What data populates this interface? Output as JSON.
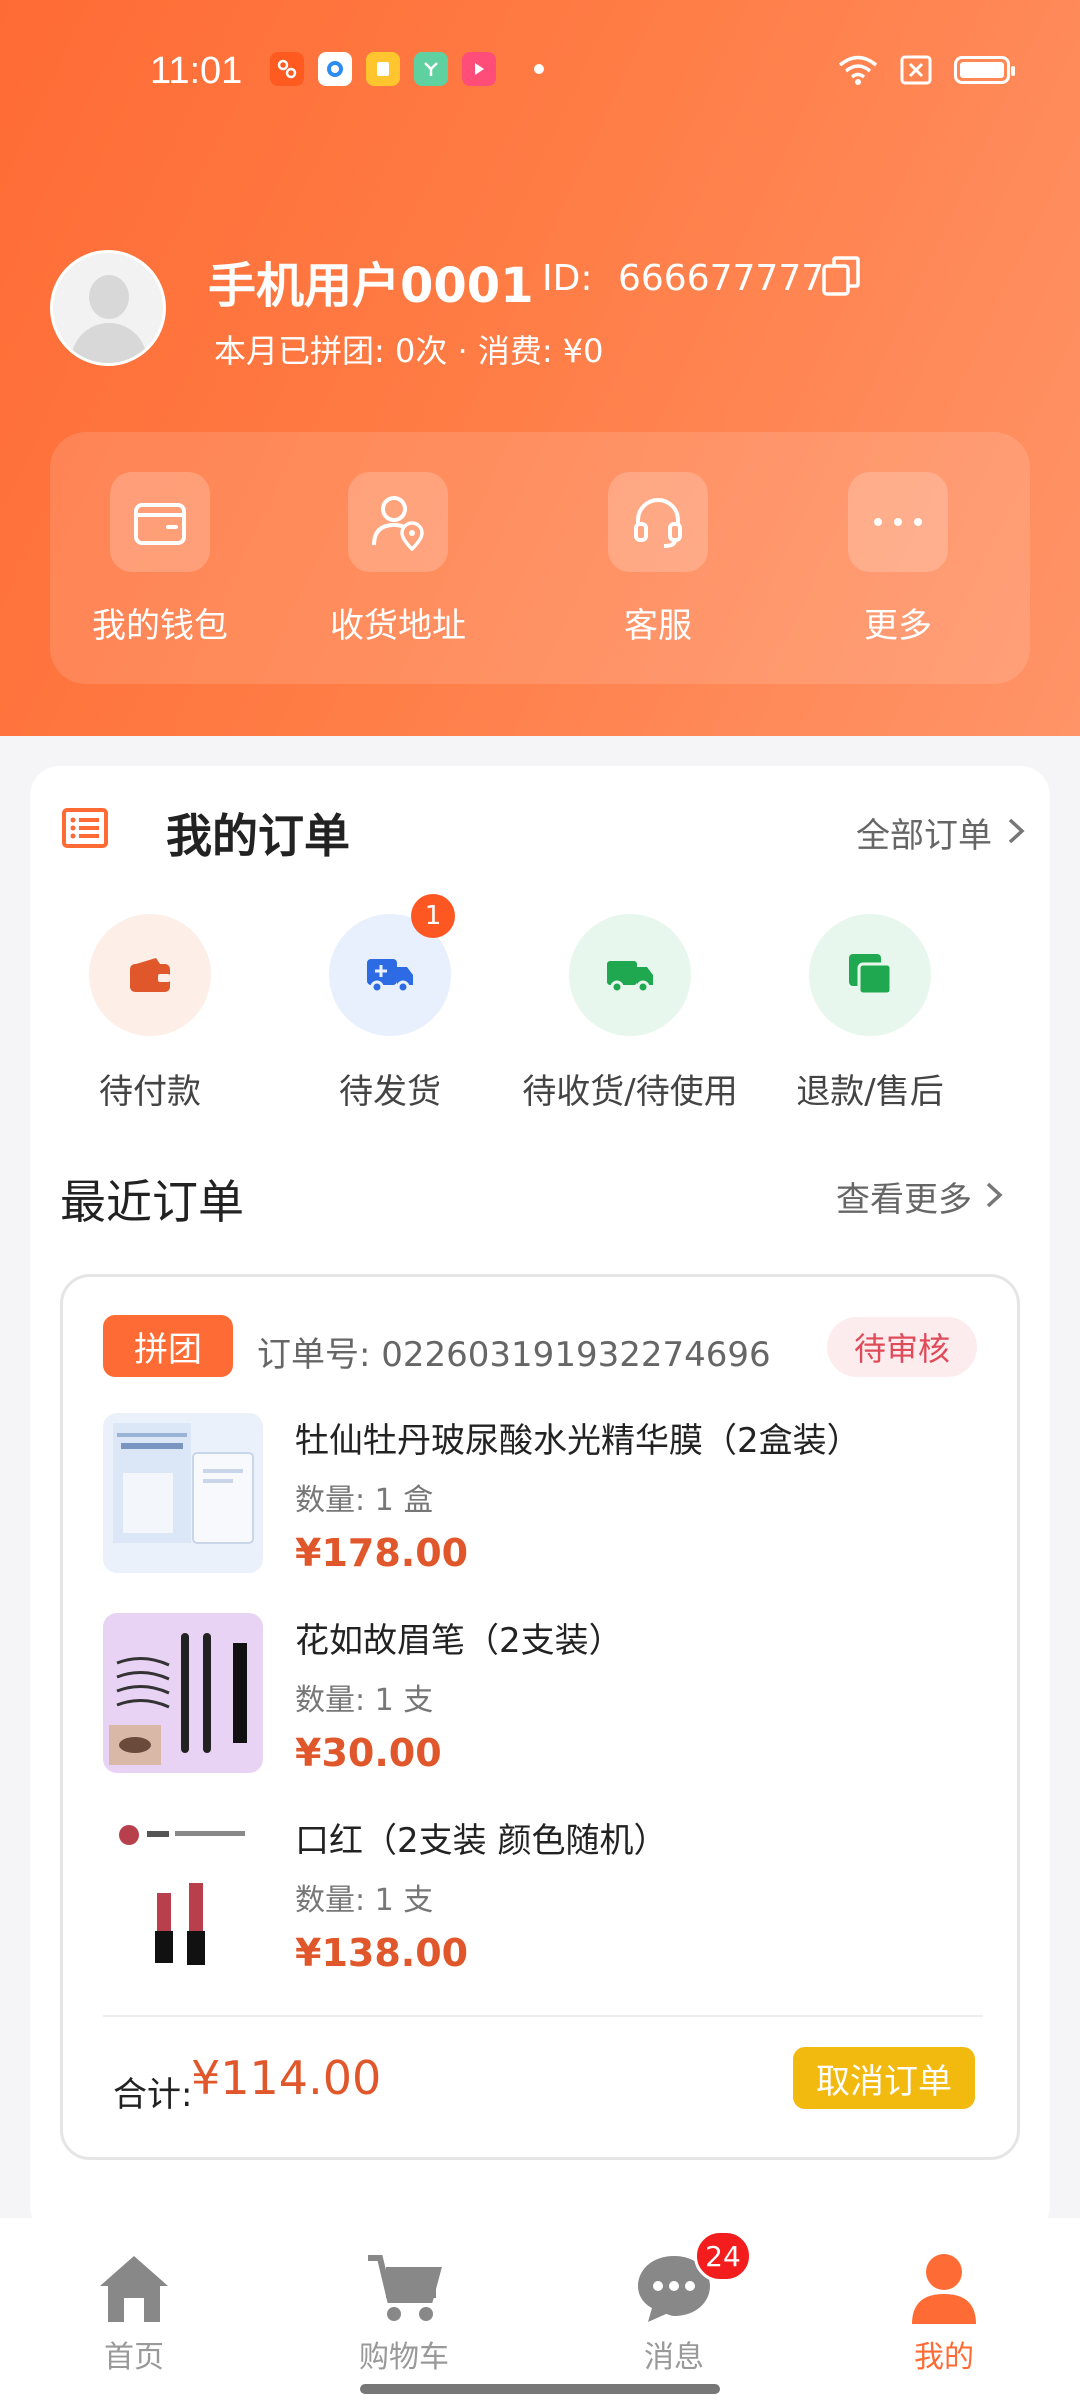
{
  "status_bar": {
    "time": "11:01"
  },
  "profile": {
    "username": "手机用户0001",
    "id_label": "ID:",
    "id_value": "666677777",
    "stats": "本月已拼团: 0次 · 消费: ¥0"
  },
  "quick_actions": [
    {
      "label": "我的钱包",
      "icon": "wallet-icon"
    },
    {
      "label": "收货地址",
      "icon": "location-user-icon"
    },
    {
      "label": "客服",
      "icon": "headset-icon"
    },
    {
      "label": "更多",
      "icon": "more-icon"
    }
  ],
  "orders": {
    "title": "我的订单",
    "all_orders": "全部订单",
    "statuses": [
      {
        "label": "待付款",
        "icon": "wallet-icon",
        "color": "#e0572b",
        "bg": "#fdeee8",
        "badge": ""
      },
      {
        "label": "待发货",
        "icon": "truck-icon",
        "color": "#2d6be4",
        "bg": "#e8f0fd",
        "badge": "1"
      },
      {
        "label": "待收货/待使用",
        "icon": "delivery-truck-icon",
        "color": "#1fa84f",
        "bg": "#e8f7ed",
        "badge": ""
      },
      {
        "label": "退款/售后",
        "icon": "refund-icon",
        "color": "#1fa84f",
        "bg": "#e8f7ed",
        "badge": ""
      }
    ]
  },
  "recent": {
    "title": "最近订单",
    "view_more": "查看更多",
    "order": {
      "tag": "拼团",
      "order_no": "订单号: 022603191932274696",
      "status": "待审核",
      "products": [
        {
          "name": "牡仙牡丹玻尿酸水光精华膜（2盒装）",
          "qty": "数量: 1 盒",
          "price": "¥178.00"
        },
        {
          "name": "花如故眉笔（2支装）",
          "qty": "数量: 1 支",
          "price": "¥30.00"
        },
        {
          "name": "口红（2支装 颜色随机）",
          "qty": "数量: 1 支",
          "price": "¥138.00"
        }
      ],
      "total_label": "合计:",
      "total_value": "¥114.00",
      "cancel": "取消订单"
    }
  },
  "bottom_nav": [
    {
      "label": "首页",
      "icon": "home-icon",
      "active": false,
      "badge": ""
    },
    {
      "label": "购物车",
      "icon": "cart-icon",
      "active": false,
      "badge": ""
    },
    {
      "label": "消息",
      "icon": "chat-icon",
      "active": false,
      "badge": "24"
    },
    {
      "label": "我的",
      "icon": "profile-icon",
      "active": true,
      "badge": ""
    }
  ],
  "colors": {
    "brand": "#ff6b35",
    "price": "#e0572b",
    "cancel_button": "#f2b90f",
    "nav_inactive": "#999999"
  }
}
